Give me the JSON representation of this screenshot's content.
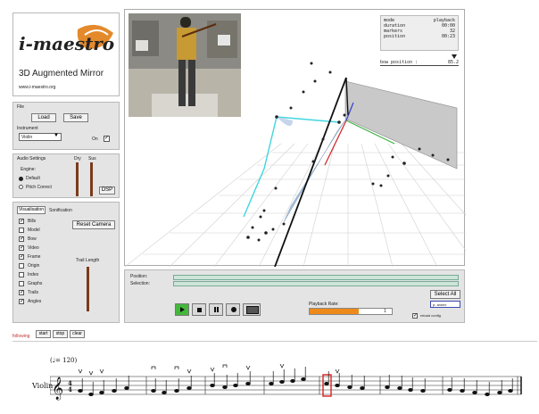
{
  "logo": {
    "brand": "i-maestro",
    "title": "3D Augmented Mirror",
    "url": "www.i-maestro.org"
  },
  "file_panel": {
    "heading": "File",
    "load_label": "Load",
    "save_label": "Save",
    "instrument_label": "Instrument",
    "instrument_value": "Violin",
    "on_label": "On"
  },
  "audio_panel": {
    "heading": "Audio Settings",
    "engine_label": "Engine:",
    "default_label": "Default",
    "pitch_label": "Pitch Correct",
    "slider1_label": "Dry",
    "slider2_label": "Sus",
    "dsp_label": "DSP"
  },
  "vis_panel": {
    "tab_visualisation": "Visualisation",
    "tab_sonification": "Sonification",
    "reset_camera": "Reset Camera",
    "trail_length": "Trail Length",
    "options": [
      {
        "label": "Bills",
        "checked": true
      },
      {
        "label": "Model",
        "checked": false
      },
      {
        "label": "Bow",
        "checked": true
      },
      {
        "label": "Video",
        "checked": true
      },
      {
        "label": "Frame",
        "checked": true
      },
      {
        "label": "Origin",
        "checked": false
      },
      {
        "label": "Index",
        "checked": false
      },
      {
        "label": "Graphs",
        "checked": false
      },
      {
        "label": "Trails",
        "checked": true
      },
      {
        "label": "Angles",
        "checked": true
      }
    ]
  },
  "info_box": {
    "rows": [
      {
        "key": "mode",
        "value": "playback"
      },
      {
        "key": "duration",
        "value": "00:00"
      },
      {
        "key": "markers",
        "value": "32"
      },
      {
        "key": "position",
        "value": "00:23"
      }
    ],
    "bow_position_label": "bow position :",
    "bow_position_value": "85.2"
  },
  "transport": {
    "position_label": "Position:",
    "selection_label": "Selection:",
    "select_all": "Select All",
    "field_value": "p: annex",
    "playback_rate_label": "Playback Rate:",
    "playback_rate_fraction": 0.6,
    "playback_rate_value": "1",
    "reload_label": "reload config"
  },
  "score_toolbar": {
    "following_label": "following",
    "start_label": "start",
    "stop_label": "stop",
    "clear_label": "clear"
  },
  "score": {
    "tempo": "(♩= 120)",
    "instrument": "Violin"
  },
  "colors": {
    "panel_bg": "#e4e4e4",
    "play_green": "#44b83c",
    "rate_orange": "#ee8a1a",
    "highlight_red": "#dd2020"
  }
}
